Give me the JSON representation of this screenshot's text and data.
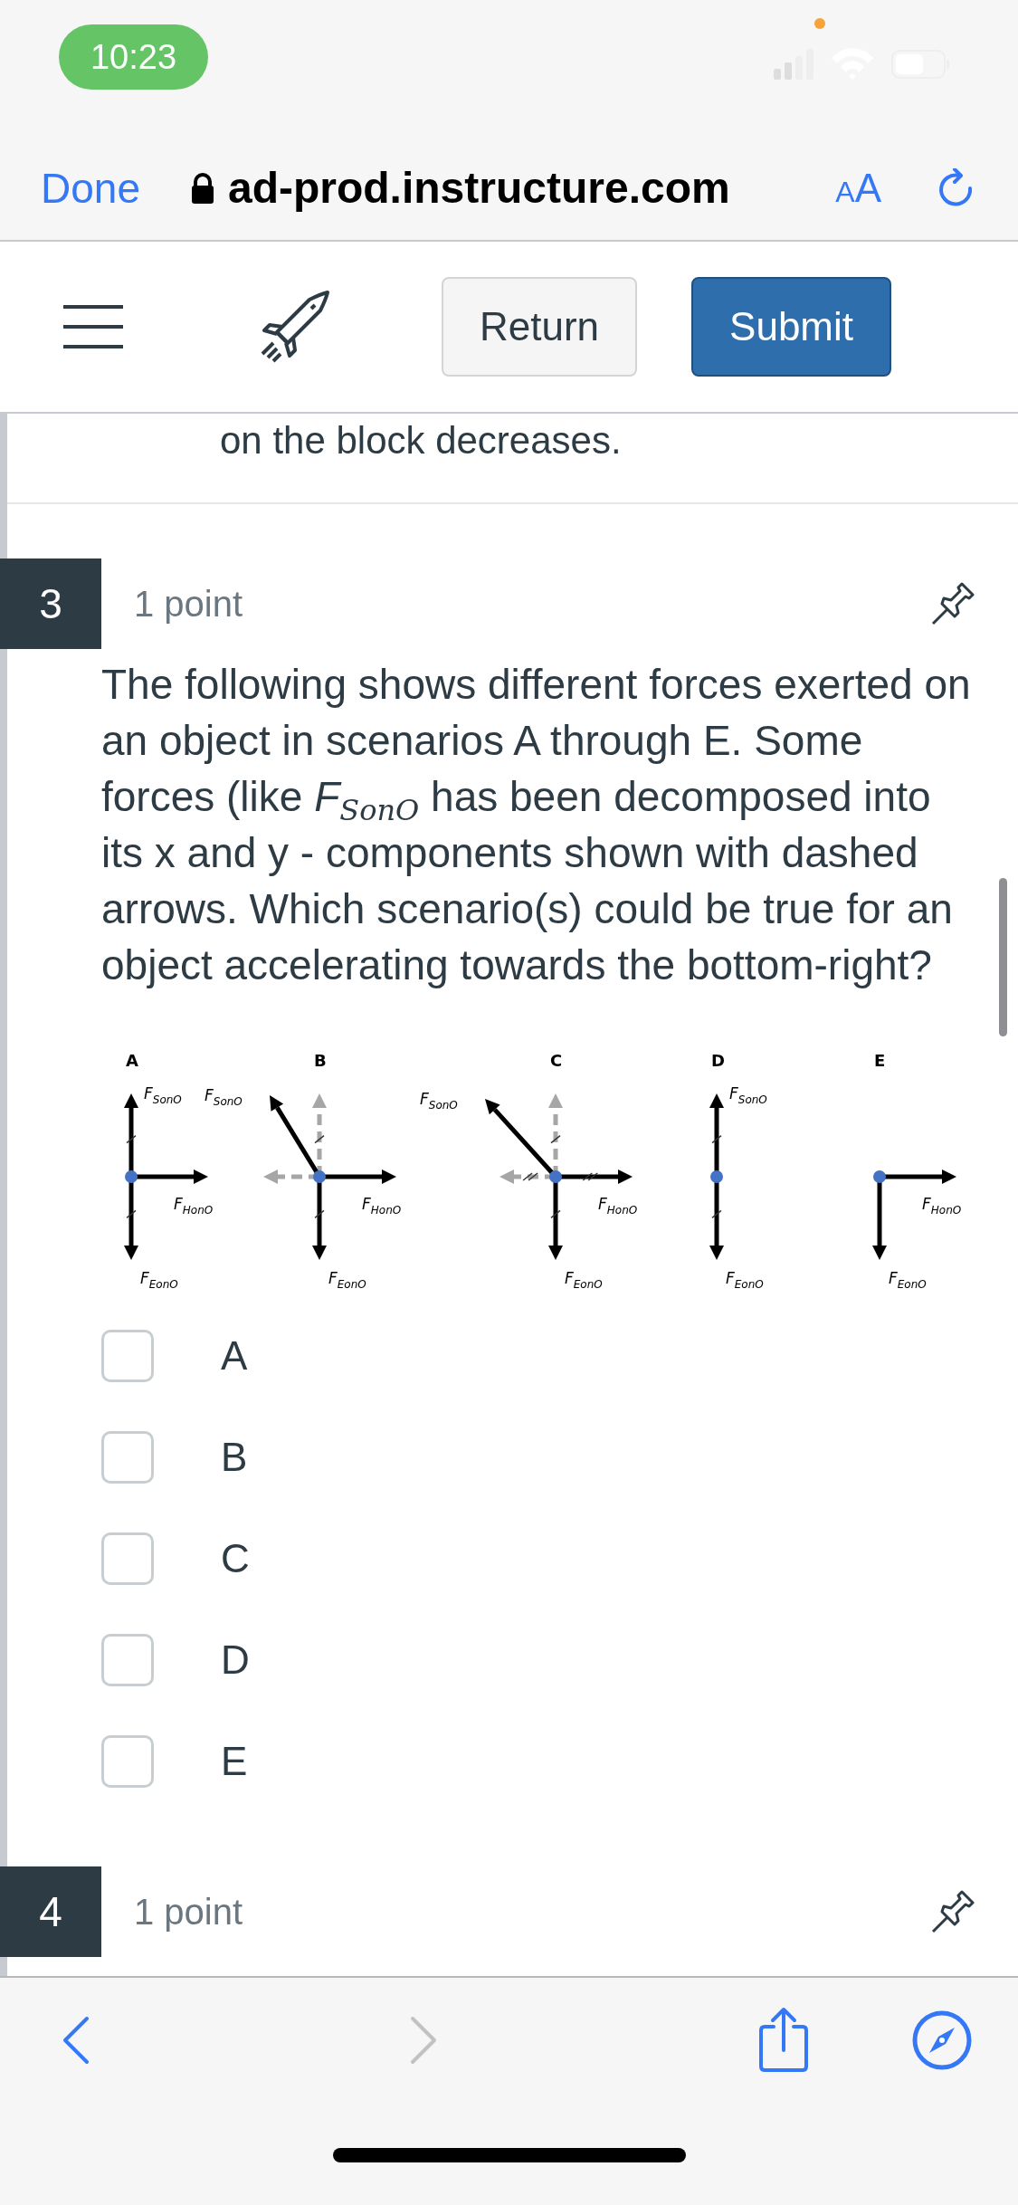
{
  "status_bar": {
    "time": "10:23"
  },
  "browser_bar": {
    "done": "Done",
    "url": "ad-prod.instructure.com",
    "text_size": "AA"
  },
  "toolbar": {
    "buttons": [
      {
        "label": "Return",
        "kind": "secondary"
      },
      {
        "label": "Submit",
        "kind": "primary"
      }
    ]
  },
  "previous_text": "on the block decreases.",
  "question": {
    "number": "3",
    "points": "1 point",
    "text": "The following shows different forces exerted on an object in scenarios A through E. Some forces (like *F*$_{SonO}$ has been decomposed into its x and y - components shown with dashed arrows. Which scenario(s) could be true for an object accelerating towards the bottom-right?",
    "scenarios": [
      {
        "letter": "A",
        "forces": [
          {
            "kind": "up-marked",
            "symbol": "F",
            "subscript": "SonO"
          },
          {
            "kind": "right",
            "symbol": "F",
            "subscript": "HonO"
          },
          {
            "kind": "down-marked",
            "symbol": "F",
            "subscript": "EonO"
          }
        ]
      },
      {
        "letter": "B",
        "forces": [
          {
            "kind": "component-up-marked"
          },
          {
            "kind": "component-left"
          },
          {
            "kind": "up-left-steep",
            "symbol": "F",
            "subscript": "SonO"
          },
          {
            "kind": "right",
            "symbol": "F",
            "subscript": "HonO"
          },
          {
            "kind": "down-marked",
            "symbol": "F",
            "subscript": "EonO"
          }
        ]
      },
      {
        "letter": "C",
        "forces": [
          {
            "kind": "component-up-marked"
          },
          {
            "kind": "component-left-double"
          },
          {
            "kind": "up-left",
            "symbol": "F",
            "subscript": "SonO"
          },
          {
            "kind": "right-double",
            "symbol": "F",
            "subscript": "HonO"
          },
          {
            "kind": "down-marked",
            "symbol": "F",
            "subscript": "EonO"
          }
        ]
      },
      {
        "letter": "D",
        "forces": [
          {
            "kind": "up-marked",
            "symbol": "F",
            "subscript": "SonO"
          },
          {
            "kind": "down-marked",
            "symbol": "F",
            "subscript": "EonO"
          }
        ]
      },
      {
        "letter": "E",
        "forces": [
          {
            "kind": "right",
            "symbol": "F",
            "subscript": "HonO"
          },
          {
            "kind": "down",
            "symbol": "F",
            "subscript": "EonO"
          }
        ]
      }
    ],
    "options": [
      {
        "label": "A",
        "checked": false
      },
      {
        "label": "B",
        "checked": false
      },
      {
        "label": "C",
        "checked": false
      },
      {
        "label": "D",
        "checked": false
      },
      {
        "label": "E",
        "checked": false
      }
    ]
  },
  "next_question": {
    "number": "4",
    "points": "1 point"
  },
  "bottom_bar": {
    "back_enabled": true,
    "forward_enabled": false
  }
}
